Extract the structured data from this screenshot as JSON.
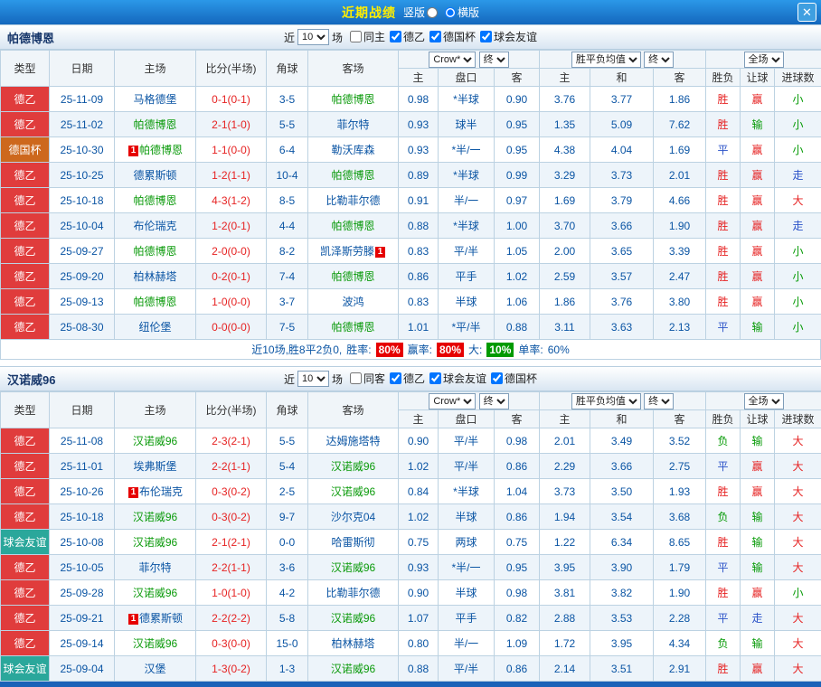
{
  "topbar": {
    "title": "近期战绩",
    "radios": [
      {
        "label": "竖版",
        "checked": false
      },
      {
        "label": "横版",
        "checked": true
      }
    ],
    "close_icon": "✕"
  },
  "controls": {
    "near_label": "近",
    "near_value": "10",
    "games_label": "场",
    "company_option": "Crow*",
    "final_option": "终",
    "avg_option": "胜平负均值",
    "scope_option": "全场"
  },
  "columns": {
    "type": "类型",
    "date": "日期",
    "home": "主场",
    "score": "比分(半场)",
    "corner": "角球",
    "away": "客场",
    "odds_home": "主",
    "odds_line": "盘口",
    "odds_away": "客",
    "avg_home": "主",
    "avg_draw": "和",
    "avg_away": "客",
    "res_wdl": "胜负",
    "res_handicap": "让球",
    "res_goals": "进球数"
  },
  "league_colors": {
    "德乙": "#e03c3c",
    "德国杯": "#cd681d",
    "球会友谊": "#2aa79b"
  },
  "result_colors": {
    "red": "#e62222",
    "blue": "#2a52c8",
    "green": "#059a05"
  },
  "colors": {
    "topbar_blue": "#1c7fd2",
    "title_yellow": "#ffee00",
    "focus_team_green": "#0a9a0a",
    "odds_navy": "#0b55a4",
    "score_red": "#e62222"
  },
  "sections": [
    {
      "team": "帕德博恩",
      "filters": [
        {
          "label": "同主",
          "checked": false
        },
        {
          "label": "德乙",
          "checked": true
        },
        {
          "label": "德国杯",
          "checked": true
        },
        {
          "label": "球会友谊",
          "checked": true
        }
      ],
      "rows": [
        {
          "type": "德乙",
          "date": "25-11-09",
          "home": "马格德堡",
          "score": "0-1(0-1)",
          "corner": "3-5",
          "away": "帕德博恩",
          "away_focus": true,
          "o1": "0.98",
          "line": "*半球",
          "o2": "0.90",
          "m1": "3.76",
          "m2": "3.77",
          "m3": "1.86",
          "r1": "胜",
          "r1c": "red",
          "r2": "赢",
          "r2c": "red",
          "r3": "小",
          "r3c": "green"
        },
        {
          "type": "德乙",
          "date": "25-11-02",
          "home": "帕德博恩",
          "home_focus": true,
          "score": "2-1(1-0)",
          "corner": "5-5",
          "away": "菲尔特",
          "o1": "0.93",
          "line": "球半",
          "o2": "0.95",
          "m1": "1.35",
          "m2": "5.09",
          "m3": "7.62",
          "r1": "胜",
          "r1c": "red",
          "r2": "输",
          "r2c": "green",
          "r3": "小",
          "r3c": "green"
        },
        {
          "type": "德国杯",
          "date": "25-10-30",
          "home": "帕德博恩",
          "home_focus": true,
          "home_badge": "1",
          "home_badge_pos": "before",
          "score": "1-1(0-0)",
          "corner": "6-4",
          "away": "勒沃库森",
          "o1": "0.93",
          "line": "*半/一",
          "o2": "0.95",
          "m1": "4.38",
          "m2": "4.04",
          "m3": "1.69",
          "r1": "平",
          "r1c": "blue",
          "r2": "赢",
          "r2c": "red",
          "r3": "小",
          "r3c": "green"
        },
        {
          "type": "德乙",
          "date": "25-10-25",
          "home": "德累斯顿",
          "score": "1-2(1-1)",
          "corner": "10-4",
          "away": "帕德博恩",
          "away_focus": true,
          "o1": "0.89",
          "line": "*半球",
          "o2": "0.99",
          "m1": "3.29",
          "m2": "3.73",
          "m3": "2.01",
          "r1": "胜",
          "r1c": "red",
          "r2": "赢",
          "r2c": "red",
          "r3": "走",
          "r3c": "blue"
        },
        {
          "type": "德乙",
          "date": "25-10-18",
          "home": "帕德博恩",
          "home_focus": true,
          "score": "4-3(1-2)",
          "corner": "8-5",
          "away": "比勒菲尔德",
          "o1": "0.91",
          "line": "半/一",
          "o2": "0.97",
          "m1": "1.69",
          "m2": "3.79",
          "m3": "4.66",
          "r1": "胜",
          "r1c": "red",
          "r2": "赢",
          "r2c": "red",
          "r3": "大",
          "r3c": "red"
        },
        {
          "type": "德乙",
          "date": "25-10-04",
          "home": "布伦瑞克",
          "score": "1-2(0-1)",
          "corner": "4-4",
          "away": "帕德博恩",
          "away_focus": true,
          "o1": "0.88",
          "line": "*半球",
          "o2": "1.00",
          "m1": "3.70",
          "m2": "3.66",
          "m3": "1.90",
          "r1": "胜",
          "r1c": "red",
          "r2": "赢",
          "r2c": "red",
          "r3": "走",
          "r3c": "blue"
        },
        {
          "type": "德乙",
          "date": "25-09-27",
          "home": "帕德博恩",
          "home_focus": true,
          "score": "2-0(0-0)",
          "corner": "8-2",
          "away": "凯泽斯劳滕",
          "away_badge": "1",
          "away_badge_pos": "after",
          "o1": "0.83",
          "line": "平/半",
          "o2": "1.05",
          "m1": "2.00",
          "m2": "3.65",
          "m3": "3.39",
          "r1": "胜",
          "r1c": "red",
          "r2": "赢",
          "r2c": "red",
          "r3": "小",
          "r3c": "green"
        },
        {
          "type": "德乙",
          "date": "25-09-20",
          "home": "柏林赫塔",
          "score": "0-2(0-1)",
          "corner": "7-4",
          "away": "帕德博恩",
          "away_focus": true,
          "o1": "0.86",
          "line": "平手",
          "o2": "1.02",
          "m1": "2.59",
          "m2": "3.57",
          "m3": "2.47",
          "r1": "胜",
          "r1c": "red",
          "r2": "赢",
          "r2c": "red",
          "r3": "小",
          "r3c": "green"
        },
        {
          "type": "德乙",
          "date": "25-09-13",
          "home": "帕德博恩",
          "home_focus": true,
          "score": "1-0(0-0)",
          "corner": "3-7",
          "away": "波鸿",
          "o1": "0.83",
          "line": "半球",
          "o2": "1.06",
          "m1": "1.86",
          "m2": "3.76",
          "m3": "3.80",
          "r1": "胜",
          "r1c": "red",
          "r2": "赢",
          "r2c": "red",
          "r3": "小",
          "r3c": "green"
        },
        {
          "type": "德乙",
          "date": "25-08-30",
          "home": "纽伦堡",
          "score": "0-0(0-0)",
          "corner": "7-5",
          "away": "帕德博恩",
          "away_focus": true,
          "o1": "1.01",
          "line": "*平/半",
          "o2": "0.88",
          "m1": "3.11",
          "m2": "3.63",
          "m3": "2.13",
          "r1": "平",
          "r1c": "blue",
          "r2": "输",
          "r2c": "green",
          "r3": "小",
          "r3c": "green"
        }
      ],
      "summary": {
        "text": "近10场,胜8平2负0,",
        "win_label": "胜率:",
        "win_value": "80%",
        "cover_label": "赢率:",
        "cover_value": "80%",
        "big_label": "大:",
        "big_value": "10%",
        "single_label": "单率:",
        "single_value": "60%"
      }
    },
    {
      "team": "汉诺威96",
      "filters": [
        {
          "label": "同客",
          "checked": false
        },
        {
          "label": "德乙",
          "checked": true
        },
        {
          "label": "球会友谊",
          "checked": true
        },
        {
          "label": "德国杯",
          "checked": true
        }
      ],
      "rows": [
        {
          "type": "德乙",
          "date": "25-11-08",
          "home": "汉诺威96",
          "home_focus": true,
          "score": "2-3(2-1)",
          "corner": "5-5",
          "away": "达姆施塔特",
          "o1": "0.90",
          "line": "平/半",
          "o2": "0.98",
          "m1": "2.01",
          "m2": "3.49",
          "m3": "3.52",
          "r1": "负",
          "r1c": "green",
          "r2": "输",
          "r2c": "green",
          "r3": "大",
          "r3c": "red"
        },
        {
          "type": "德乙",
          "date": "25-11-01",
          "home": "埃弗斯堡",
          "score": "2-2(1-1)",
          "corner": "5-4",
          "away": "汉诺威96",
          "away_focus": true,
          "o1": "1.02",
          "line": "平/半",
          "o2": "0.86",
          "m1": "2.29",
          "m2": "3.66",
          "m3": "2.75",
          "r1": "平",
          "r1c": "blue",
          "r2": "赢",
          "r2c": "red",
          "r3": "大",
          "r3c": "red"
        },
        {
          "type": "德乙",
          "date": "25-10-26",
          "home": "布伦瑞克",
          "home_badge": "1",
          "home_badge_pos": "before",
          "score": "0-3(0-2)",
          "corner": "2-5",
          "away": "汉诺威96",
          "away_focus": true,
          "o1": "0.84",
          "line": "*半球",
          "o2": "1.04",
          "m1": "3.73",
          "m2": "3.50",
          "m3": "1.93",
          "r1": "胜",
          "r1c": "red",
          "r2": "赢",
          "r2c": "red",
          "r3": "大",
          "r3c": "red"
        },
        {
          "type": "德乙",
          "date": "25-10-18",
          "home": "汉诺威96",
          "home_focus": true,
          "score": "0-3(0-2)",
          "corner": "9-7",
          "away": "沙尔克04",
          "o1": "1.02",
          "line": "半球",
          "o2": "0.86",
          "m1": "1.94",
          "m2": "3.54",
          "m3": "3.68",
          "r1": "负",
          "r1c": "green",
          "r2": "输",
          "r2c": "green",
          "r3": "大",
          "r3c": "red"
        },
        {
          "type": "球会友谊",
          "date": "25-10-08",
          "home": "汉诺威96",
          "home_focus": true,
          "score": "2-1(2-1)",
          "corner": "0-0",
          "away": "哈雷斯彻",
          "o1": "0.75",
          "line": "两球",
          "o2": "0.75",
          "m1": "1.22",
          "m2": "6.34",
          "m3": "8.65",
          "r1": "胜",
          "r1c": "red",
          "r2": "输",
          "r2c": "green",
          "r3": "大",
          "r3c": "red"
        },
        {
          "type": "德乙",
          "date": "25-10-05",
          "home": "菲尔特",
          "score": "2-2(1-1)",
          "corner": "3-6",
          "away": "汉诺威96",
          "away_focus": true,
          "o1": "0.93",
          "line": "*半/一",
          "o2": "0.95",
          "m1": "3.95",
          "m2": "3.90",
          "m3": "1.79",
          "r1": "平",
          "r1c": "blue",
          "r2": "输",
          "r2c": "green",
          "r3": "大",
          "r3c": "red"
        },
        {
          "type": "德乙",
          "date": "25-09-28",
          "home": "汉诺威96",
          "home_focus": true,
          "score": "1-0(1-0)",
          "corner": "4-2",
          "away": "比勒菲尔德",
          "o1": "0.90",
          "line": "半球",
          "o2": "0.98",
          "m1": "3.81",
          "m2": "3.82",
          "m3": "1.90",
          "r1": "胜",
          "r1c": "red",
          "r2": "赢",
          "r2c": "red",
          "r3": "小",
          "r3c": "green"
        },
        {
          "type": "德乙",
          "date": "25-09-21",
          "home": "德累斯顿",
          "home_badge": "1",
          "home_badge_pos": "before",
          "score": "2-2(2-2)",
          "corner": "5-8",
          "away": "汉诺威96",
          "away_focus": true,
          "o1": "1.07",
          "line": "平手",
          "o2": "0.82",
          "m1": "2.88",
          "m2": "3.53",
          "m3": "2.28",
          "r1": "平",
          "r1c": "blue",
          "r2": "走",
          "r2c": "blue",
          "r3": "大",
          "r3c": "red"
        },
        {
          "type": "德乙",
          "date": "25-09-14",
          "home": "汉诺威96",
          "home_focus": true,
          "score": "0-3(0-0)",
          "corner": "15-0",
          "away": "柏林赫塔",
          "o1": "0.80",
          "line": "半/一",
          "o2": "1.09",
          "m1": "1.72",
          "m2": "3.95",
          "m3": "4.34",
          "r1": "负",
          "r1c": "green",
          "r2": "输",
          "r2c": "green",
          "r3": "大",
          "r3c": "red"
        },
        {
          "type": "球会友谊",
          "date": "25-09-04",
          "home": "汉堡",
          "score": "1-3(0-2)",
          "corner": "1-3",
          "away": "汉诺威96",
          "away_focus": true,
          "o1": "0.88",
          "line": "平/半",
          "o2": "0.86",
          "m1": "2.14",
          "m2": "3.51",
          "m3": "2.91",
          "r1": "胜",
          "r1c": "red",
          "r2": "赢",
          "r2c": "red",
          "r3": "大",
          "r3c": "red"
        }
      ]
    }
  ]
}
